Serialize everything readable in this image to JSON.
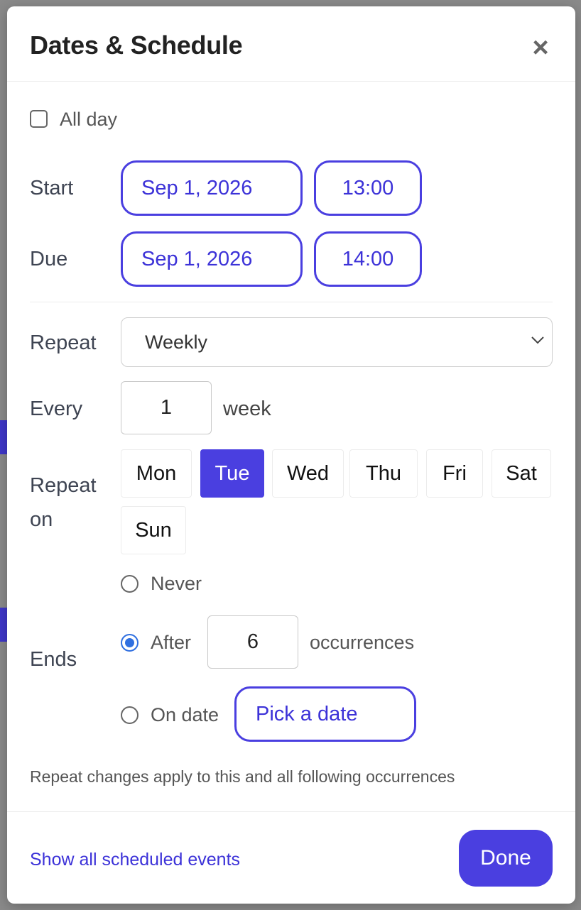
{
  "dialog": {
    "title": "Dates & Schedule"
  },
  "all_day": {
    "label": "All day",
    "checked": false
  },
  "start": {
    "label": "Start",
    "date": "Sep 1, 2026",
    "time": "13:00"
  },
  "due": {
    "label": "Due",
    "date": "Sep 1, 2026",
    "time": "14:00"
  },
  "repeat": {
    "label": "Repeat",
    "selected": "Weekly"
  },
  "every": {
    "label": "Every",
    "value": "1",
    "unit": "week"
  },
  "repeat_on": {
    "label_line1": "Repeat",
    "label_line2": "on",
    "days": [
      "Mon",
      "Tue",
      "Wed",
      "Thu",
      "Fri",
      "Sat",
      "Sun"
    ],
    "selected": "Tue"
  },
  "ends": {
    "label": "Ends",
    "never_label": "Never",
    "after_label": "After",
    "after_value": "6",
    "after_unit": "occurrences",
    "on_date_label": "On date",
    "on_date_placeholder": "Pick a date",
    "selected": "after"
  },
  "note": "Repeat changes apply to this and all following occurrences",
  "footer": {
    "link": "Show all scheduled events",
    "done": "Done"
  },
  "colors": {
    "accent": "#4a3fe0",
    "radio": "#2f6fe0"
  }
}
